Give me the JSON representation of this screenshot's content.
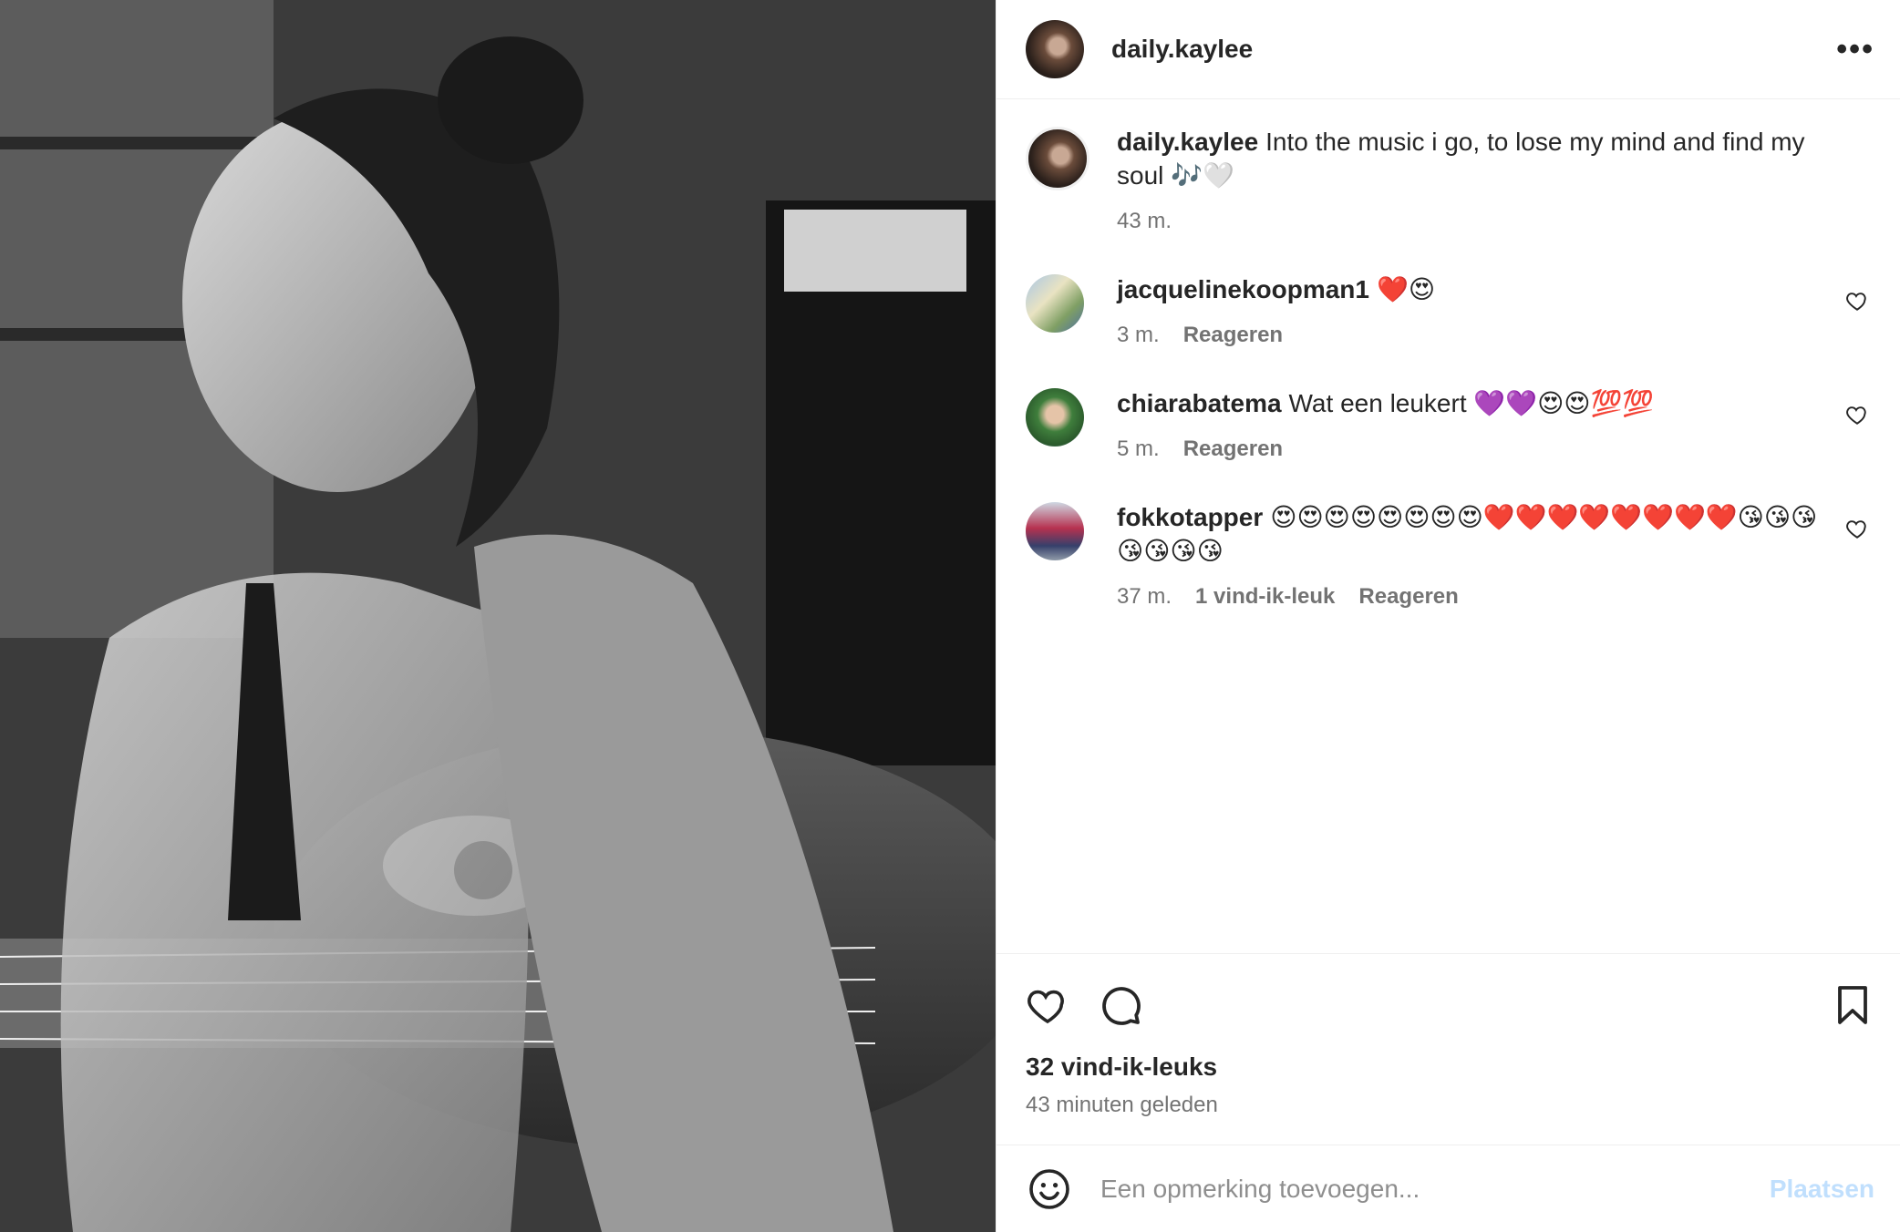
{
  "post": {
    "username": "daily.kaylee",
    "more_icon": "more-horizontal-icon",
    "more_label": "•••"
  },
  "caption": {
    "username": "daily.kaylee",
    "text": "Into the music i go, to lose my mind and find my soul 🎶🤍",
    "time": "43 m."
  },
  "comments": [
    {
      "username": "jacquelinekoopman1",
      "text": "❤️😍",
      "time": "3 m.",
      "likes": "",
      "reply": "Reageren"
    },
    {
      "username": "chiarabatema",
      "text": "Wat een leukert 💜💜😍😍💯💯",
      "time": "5 m.",
      "likes": "",
      "reply": "Reageren"
    },
    {
      "username": "fokkotapper",
      "text": "😍😍😍😍😍😍😍😍❤️❤️❤️❤️❤️❤️❤️❤️😘😘😘😘😘😘😘",
      "time": "37 m.",
      "likes": "1 vind-ik-leuk",
      "reply": "Reageren"
    }
  ],
  "actions": {
    "icons": [
      "heart-icon",
      "comment-icon",
      "bookmark-icon"
    ],
    "likes_count": "32 vind-ik-leuks",
    "time_ago": "43 minuten geleden"
  },
  "add_comment": {
    "placeholder": "Een opmerking toevoegen...",
    "post_label": "Plaatsen",
    "post_color": "#c0dffd"
  }
}
